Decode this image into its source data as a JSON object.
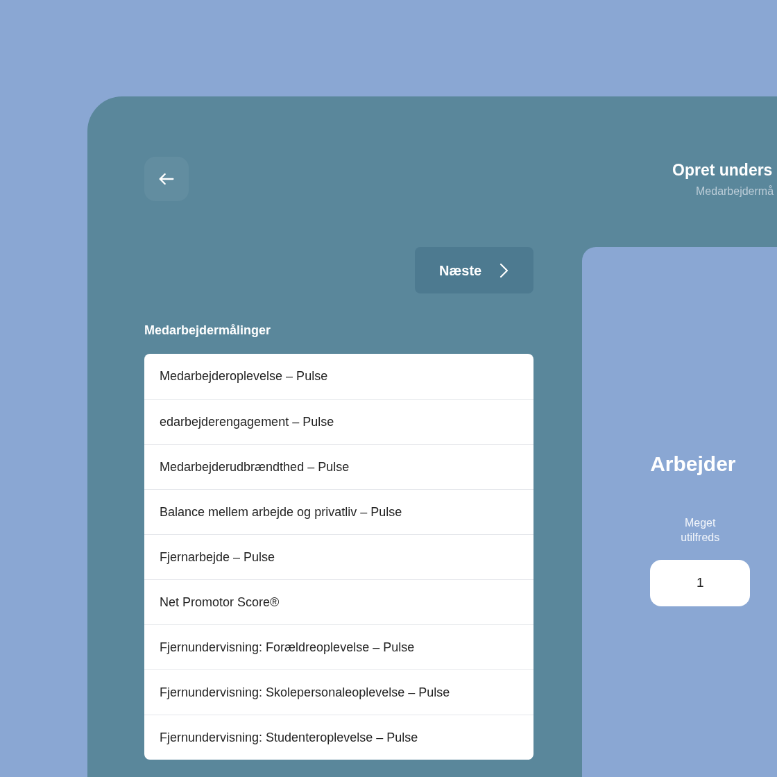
{
  "header": {
    "title": "Opret unders",
    "subtitle": "Medarbejdermå"
  },
  "next_button": {
    "label": "Næste"
  },
  "list": {
    "heading": "Medarbejdermålinger",
    "items": [
      {
        "label": "Medarbejderoplevelse – Pulse"
      },
      {
        "label": "edarbejderengagement – Pulse"
      },
      {
        "label": "Medarbejderudbrændthed – Pulse"
      },
      {
        "label": "Balance mellem arbejde og privatliv – Pulse"
      },
      {
        "label": "Fjernarbejde – Pulse"
      },
      {
        "label": "Net Promotor Score®"
      },
      {
        "label": "Fjernundervisning: Forældreoplevelse – Pulse"
      },
      {
        "label": "Fjernundervisning: Skolepersonaleoplevelse – Pulse"
      },
      {
        "label": "Fjernundervisning: Studenteroplevelse – Pulse"
      }
    ]
  },
  "preview": {
    "question": "Arbejder",
    "scale": [
      {
        "caption": "Meget utilfreds",
        "value": "1"
      }
    ]
  }
}
